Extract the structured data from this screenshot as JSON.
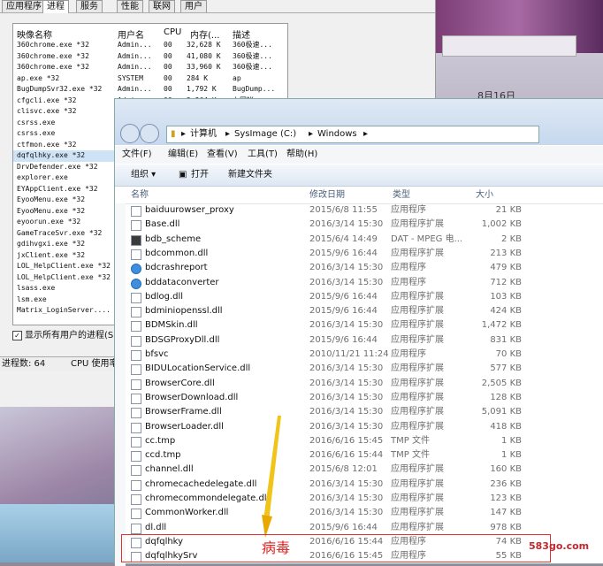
{
  "task_manager": {
    "tabs": [
      "应用程序",
      "进程",
      "服务",
      "性能",
      "联网",
      "用户"
    ],
    "active_tab": "进程",
    "columns": [
      "映像名称",
      "用户名",
      "CPU",
      "内存(...",
      "描述"
    ],
    "rows": [
      {
        "name": "360chrome.exe *32",
        "user": "Admin...",
        "cpu": "00",
        "mem": "32,628 K",
        "desc": "360极速..."
      },
      {
        "name": "360chrome.exe *32",
        "user": "Admin...",
        "cpu": "00",
        "mem": "41,080 K",
        "desc": "360极速..."
      },
      {
        "name": "360chrome.exe *32",
        "user": "Admin...",
        "cpu": "00",
        "mem": "33,960 K",
        "desc": "360极速..."
      },
      {
        "name": "ap.exe *32",
        "user": "SYSTEM",
        "cpu": "00",
        "mem": "284 K",
        "desc": "ap"
      },
      {
        "name": "BugDumpSvr32.exe *32",
        "user": "Admin...",
        "cpu": "00",
        "mem": "1,792 K",
        "desc": "BugDump..."
      },
      {
        "name": "cfgcli.exe *32",
        "user": "Admin...",
        "cpu": "00",
        "mem": "2,964 K",
        "desc": "上网帐..."
      },
      {
        "name": "clisvc.exe *32",
        "user": "",
        "cpu": "",
        "mem": "",
        "desc": ""
      },
      {
        "name": "csrss.exe",
        "user": "",
        "cpu": "",
        "mem": "",
        "desc": ""
      },
      {
        "name": "csrss.exe",
        "user": "",
        "cpu": "",
        "mem": "",
        "desc": ""
      },
      {
        "name": "ctfmon.exe *32",
        "user": "",
        "cpu": "",
        "mem": "",
        "desc": ""
      },
      {
        "name": "dqfqlhky.exe *32",
        "user": "",
        "cpu": "",
        "mem": "",
        "desc": ""
      },
      {
        "name": "DrvDefender.exe *32",
        "user": "",
        "cpu": "",
        "mem": "",
        "desc": ""
      },
      {
        "name": "explorer.exe",
        "user": "",
        "cpu": "",
        "mem": "",
        "desc": ""
      },
      {
        "name": "EYAppClient.exe *32",
        "user": "",
        "cpu": "",
        "mem": "",
        "desc": ""
      },
      {
        "name": "EyooMenu.exe *32",
        "user": "",
        "cpu": "",
        "mem": "",
        "desc": ""
      },
      {
        "name": "EyooMenu.exe *32",
        "user": "",
        "cpu": "",
        "mem": "",
        "desc": ""
      },
      {
        "name": "eyoorun.exe *32",
        "user": "",
        "cpu": "",
        "mem": "",
        "desc": ""
      },
      {
        "name": "GameTraceSvr.exe *32",
        "user": "",
        "cpu": "",
        "mem": "",
        "desc": ""
      },
      {
        "name": "gdihvgxi.exe *32",
        "user": "",
        "cpu": "",
        "mem": "",
        "desc": ""
      },
      {
        "name": "jxClient.exe *32",
        "user": "",
        "cpu": "",
        "mem": "",
        "desc": ""
      },
      {
        "name": "LOL_HelpClient.exe *32",
        "user": "",
        "cpu": "",
        "mem": "",
        "desc": ""
      },
      {
        "name": "LOL_HelpClient.exe *32",
        "user": "",
        "cpu": "",
        "mem": "",
        "desc": ""
      },
      {
        "name": "lsass.exe",
        "user": "",
        "cpu": "",
        "mem": "",
        "desc": ""
      },
      {
        "name": "lsm.exe",
        "user": "",
        "cpu": "",
        "mem": "",
        "desc": ""
      },
      {
        "name": "Matrix_LoginServer....",
        "user": "",
        "cpu": "",
        "mem": "",
        "desc": ""
      }
    ],
    "show_all_label": "显示所有用户的进程(S)",
    "process_count": "进程数: 64",
    "cpu_usage": "CPU 使用率"
  },
  "background": {
    "date_fragment": "8月16日"
  },
  "explorer": {
    "address": [
      "计算机",
      "SysImage (C:)",
      "Windows"
    ],
    "menu": [
      "文件(F)",
      "编辑(E)",
      "查看(V)",
      "工具(T)",
      "帮助(H)"
    ],
    "toolbar": {
      "organize": "组织 ▾",
      "open": "打开",
      "new_folder": "新建文件夹"
    },
    "columns": {
      "name": "名称",
      "date": "修改日期",
      "type": "类型",
      "size": "大小"
    },
    "files": [
      {
        "name": "baiduurowser_proxy",
        "date": "2015/6/8 11:55",
        "type": "应用程序",
        "size": "21 KB",
        "icon": "app"
      },
      {
        "name": "Base.dll",
        "date": "2016/3/14 15:30",
        "type": "应用程序扩展",
        "size": "1,002 KB",
        "icon": "dll"
      },
      {
        "name": "bdb_scheme",
        "date": "2015/6/4 14:49",
        "type": "DAT - MPEG 电...",
        "size": "2 KB",
        "icon": "media"
      },
      {
        "name": "bdcommon.dll",
        "date": "2015/9/6 16:44",
        "type": "应用程序扩展",
        "size": "213 KB",
        "icon": "dll"
      },
      {
        "name": "bdcrashreport",
        "date": "2016/3/14 15:30",
        "type": "应用程序",
        "size": "479 KB",
        "icon": "blue"
      },
      {
        "name": "bddataconverter",
        "date": "2016/3/14 15:30",
        "type": "应用程序",
        "size": "712 KB",
        "icon": "blue"
      },
      {
        "name": "bdlog.dll",
        "date": "2015/9/6 16:44",
        "type": "应用程序扩展",
        "size": "103 KB",
        "icon": "dll"
      },
      {
        "name": "bdminiopenssl.dll",
        "date": "2015/9/6 16:44",
        "type": "应用程序扩展",
        "size": "424 KB",
        "icon": "dll"
      },
      {
        "name": "BDMSkin.dll",
        "date": "2016/3/14 15:30",
        "type": "应用程序扩展",
        "size": "1,472 KB",
        "icon": "dll"
      },
      {
        "name": "BDSGProxyDll.dll",
        "date": "2015/9/6 16:44",
        "type": "应用程序扩展",
        "size": "831 KB",
        "icon": "dll"
      },
      {
        "name": "bfsvc",
        "date": "2010/11/21 11:24",
        "type": "应用程序",
        "size": "70 KB",
        "icon": "app"
      },
      {
        "name": "BIDULocationService.dll",
        "date": "2016/3/14 15:30",
        "type": "应用程序扩展",
        "size": "577 KB",
        "icon": "dll"
      },
      {
        "name": "BrowserCore.dll",
        "date": "2016/3/14 15:30",
        "type": "应用程序扩展",
        "size": "2,505 KB",
        "icon": "dll"
      },
      {
        "name": "BrowserDownload.dll",
        "date": "2016/3/14 15:30",
        "type": "应用程序扩展",
        "size": "128 KB",
        "icon": "dll"
      },
      {
        "name": "BrowserFrame.dll",
        "date": "2016/3/14 15:30",
        "type": "应用程序扩展",
        "size": "5,091 KB",
        "icon": "dll"
      },
      {
        "name": "BrowserLoader.dll",
        "date": "2016/3/14 15:30",
        "type": "应用程序扩展",
        "size": "418 KB",
        "icon": "dll"
      },
      {
        "name": "cc.tmp",
        "date": "2016/6/16 15:45",
        "type": "TMP 文件",
        "size": "1 KB",
        "icon": "file"
      },
      {
        "name": "ccd.tmp",
        "date": "2016/6/16 15:44",
        "type": "TMP 文件",
        "size": "1 KB",
        "icon": "file"
      },
      {
        "name": "channel.dll",
        "date": "2015/6/8 12:01",
        "type": "应用程序扩展",
        "size": "160 KB",
        "icon": "dll"
      },
      {
        "name": "chromecachedelegate.dll",
        "date": "2016/3/14 15:30",
        "type": "应用程序扩展",
        "size": "236 KB",
        "icon": "dll"
      },
      {
        "name": "chromecommondelegate.dll",
        "date": "2016/3/14 15:30",
        "type": "应用程序扩展",
        "size": "123 KB",
        "icon": "dll"
      },
      {
        "name": "CommonWorker.dll",
        "date": "2016/3/14 15:30",
        "type": "应用程序扩展",
        "size": "147 KB",
        "icon": "dll"
      },
      {
        "name": "dl.dll",
        "date": "2015/9/6 16:44",
        "type": "应用程序扩展",
        "size": "978 KB",
        "icon": "dll"
      },
      {
        "name": "dqfqlhky",
        "date": "2016/6/16 15:44",
        "type": "应用程序",
        "size": "74 KB",
        "icon": "app"
      },
      {
        "name": "dqfqlhkySrv",
        "date": "2016/6/16 15:45",
        "type": "应用程序",
        "size": "55 KB",
        "icon": "app"
      }
    ]
  },
  "annotation": {
    "label": "病毒",
    "color": "#e02020"
  },
  "watermark": "583go.com"
}
